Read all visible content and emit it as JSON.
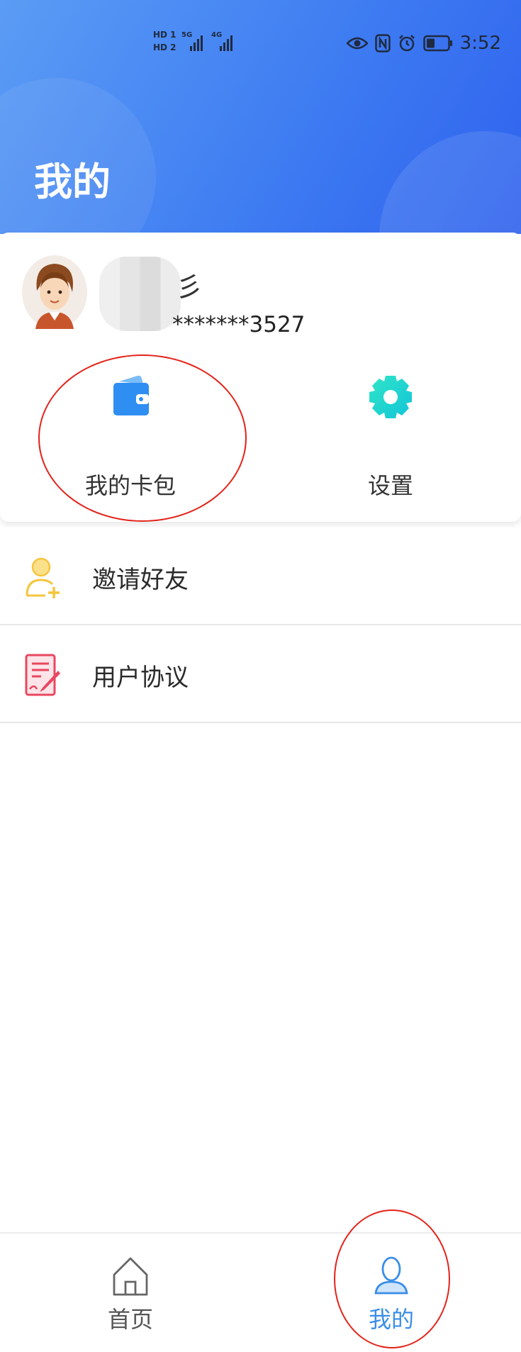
{
  "status_bar": {
    "hd1": "HD 1",
    "hd2": "HD 2",
    "net1": "5G",
    "net2": "4G",
    "time": "3:52"
  },
  "header": {
    "title": "我的"
  },
  "profile": {
    "name_visible_fragment": "彡",
    "phone": "*******3527"
  },
  "actions": [
    {
      "label": "我的卡包",
      "icon": "wallet-icon"
    },
    {
      "label": "设置",
      "icon": "gear-icon"
    }
  ],
  "menu": [
    {
      "label": "邀请好友",
      "icon": "add-user-icon"
    },
    {
      "label": "用户协议",
      "icon": "agreement-icon"
    }
  ],
  "tabs": [
    {
      "label": "首页",
      "icon": "home-icon",
      "active": false
    },
    {
      "label": "我的",
      "icon": "user-icon",
      "active": true
    }
  ],
  "colors": {
    "header_gradient_start": "#5b9cf5",
    "header_gradient_end": "#2f62ee",
    "active_tab": "#3a8ee6",
    "inactive_tab": "#555555",
    "highlight_circle": "#e3231a"
  }
}
